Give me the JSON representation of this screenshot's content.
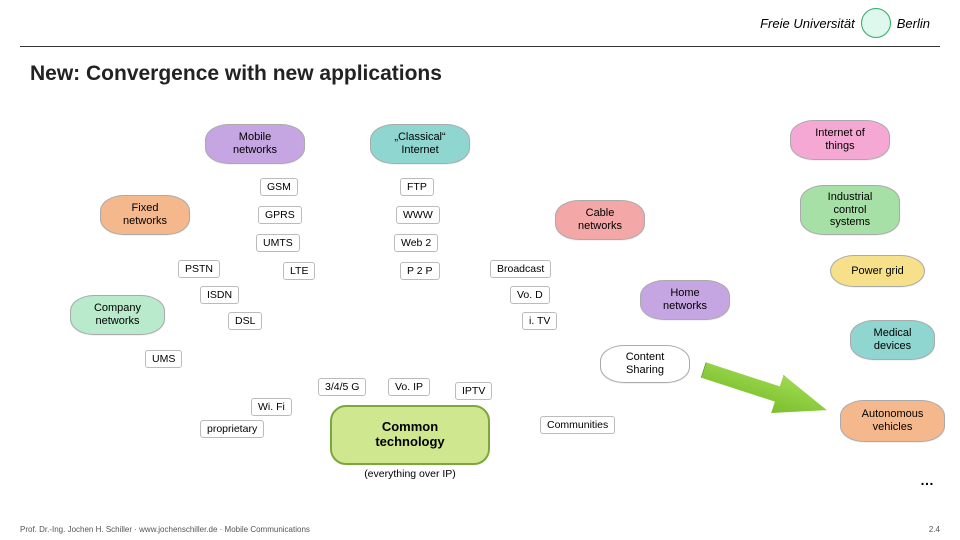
{
  "logo": {
    "text": "Freie Universität",
    "suffix": "Berlin"
  },
  "title": "New: Convergence with new applications",
  "clouds": {
    "mobile": "Mobile\nnetworks",
    "classical": "„Classical“\nInternet",
    "iot": "Internet of\nthings",
    "fixed": "Fixed\nnetworks",
    "cable": "Cable\nnetworks",
    "ics": "Industrial\ncontrol\nsystems",
    "company": "Company\nnetworks",
    "home": "Home\nnetworks",
    "medical": "Medical\ndevices",
    "content": "Content\nSharing",
    "power": "Power grid",
    "auto": "Autonomous\nvehicles"
  },
  "chips": {
    "gsm": "GSM",
    "gprs": "GPRS",
    "umts": "UMTS",
    "lte": "LTE",
    "ftp": "FTP",
    "www": "WWW",
    "web2": "Web 2",
    "p2p": "P 2 P",
    "broadcast": "Broadcast",
    "vod": "Vo. D",
    "itv": "i. TV",
    "pstn": "PSTN",
    "isdn": "ISDN",
    "dsl": "DSL",
    "ums": "UMS",
    "wifi": "Wi. Fi",
    "g345": "3/4/5 G",
    "voip": "Vo. IP",
    "iptv": "IPTV",
    "proprietary": "proprietary",
    "communities": "Communities"
  },
  "common": {
    "title": "Common\ntechnology",
    "sub": "(everything over IP)"
  },
  "ellipsis": "…",
  "footer": {
    "left": "Prof. Dr.-Ing. Jochen H. Schiller  ·  www.jochenschiller.de  ·  Mobile Communications",
    "right": "2.4"
  }
}
